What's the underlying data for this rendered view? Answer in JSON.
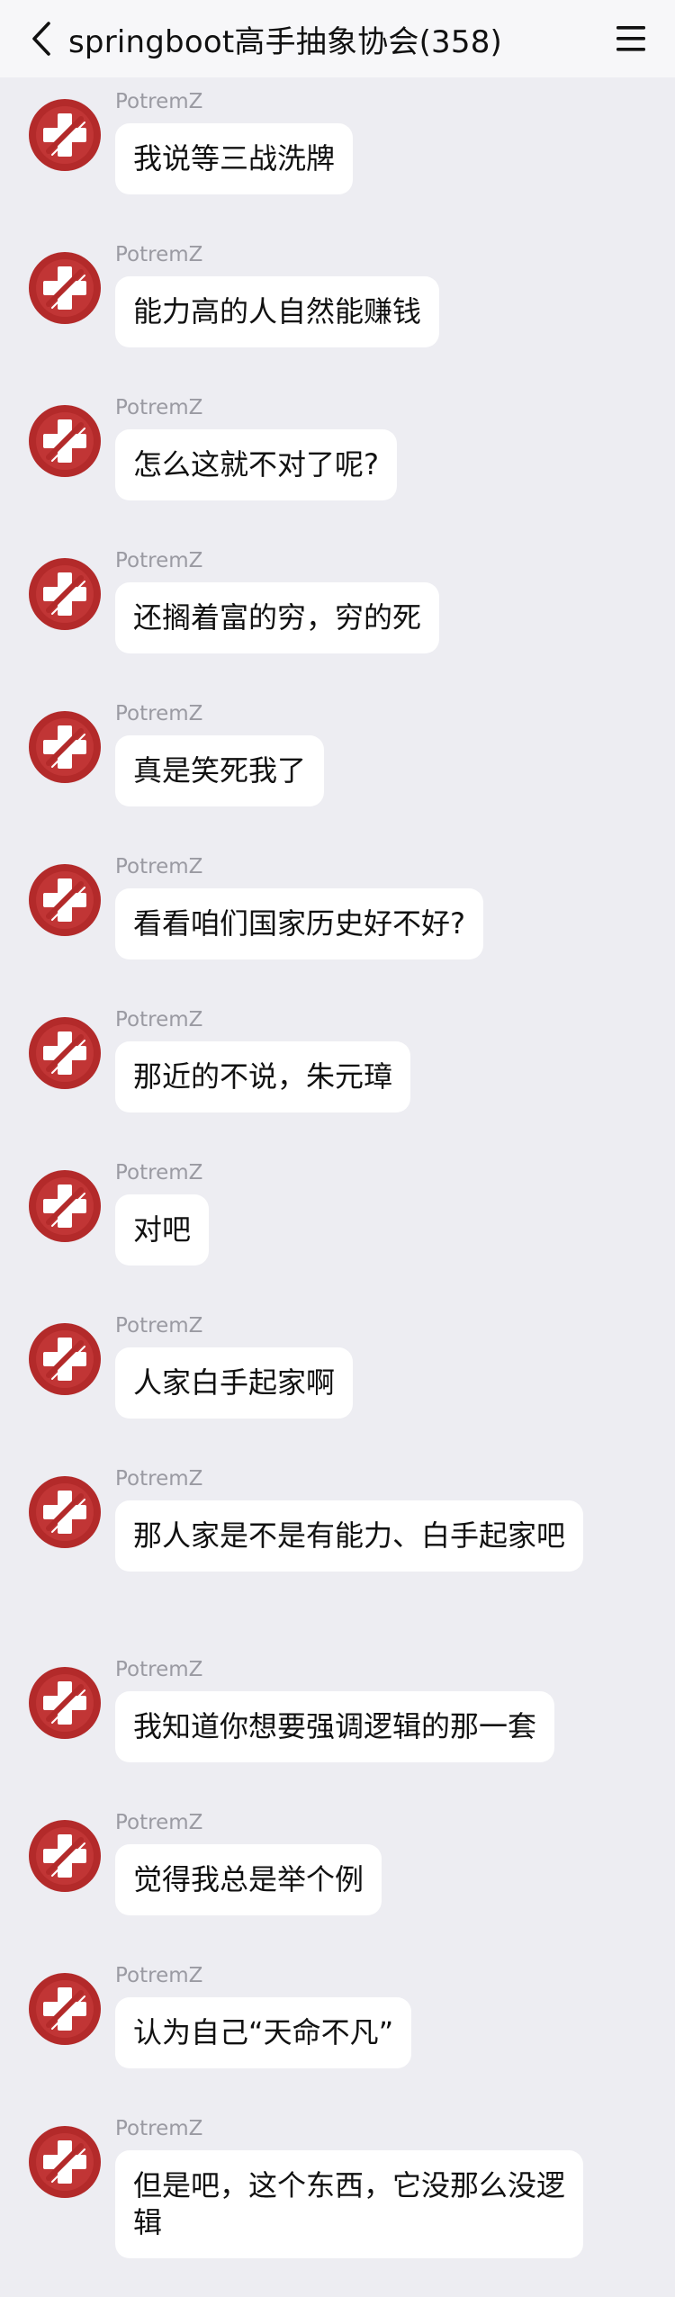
{
  "header": {
    "title": "springboot高手抽象协会(358)"
  },
  "icons": {
    "back": "chevron-left-icon",
    "menu": "hamburger-menu-icon",
    "avatar": "red-cross-avatar-icon"
  },
  "colors": {
    "background": "#ededf2",
    "avatar": "#b32a2a",
    "bubble": "#ffffff"
  },
  "messages": [
    {
      "sender": "PotremZ",
      "text": "我说等三战洗牌"
    },
    {
      "sender": "PotremZ",
      "text": "能力高的人自然能赚钱"
    },
    {
      "sender": "PotremZ",
      "text": "怎么这就不对了呢?"
    },
    {
      "sender": "PotremZ",
      "text": "还搁着富的穷，穷的死"
    },
    {
      "sender": "PotremZ",
      "text": "真是笑死我了"
    },
    {
      "sender": "PotremZ",
      "text": "看看咱们国家历史好不好?"
    },
    {
      "sender": "PotremZ",
      "text": "那近的不说，朱元璋"
    },
    {
      "sender": "PotremZ",
      "text": "对吧"
    },
    {
      "sender": "PotremZ",
      "text": "人家白手起家啊"
    },
    {
      "sender": "PotremZ",
      "text": "那人家是不是有能力、白手起家吧"
    },
    {
      "sender": "PotremZ",
      "text": "我知道你想要强调逻辑的那一套"
    },
    {
      "sender": "PotremZ",
      "text": "觉得我总是举个例"
    },
    {
      "sender": "PotremZ",
      "text": "认为自己“天命不凡”"
    },
    {
      "sender": "PotremZ",
      "text": "但是吧，这个东西，它没那么没逻辑"
    }
  ]
}
